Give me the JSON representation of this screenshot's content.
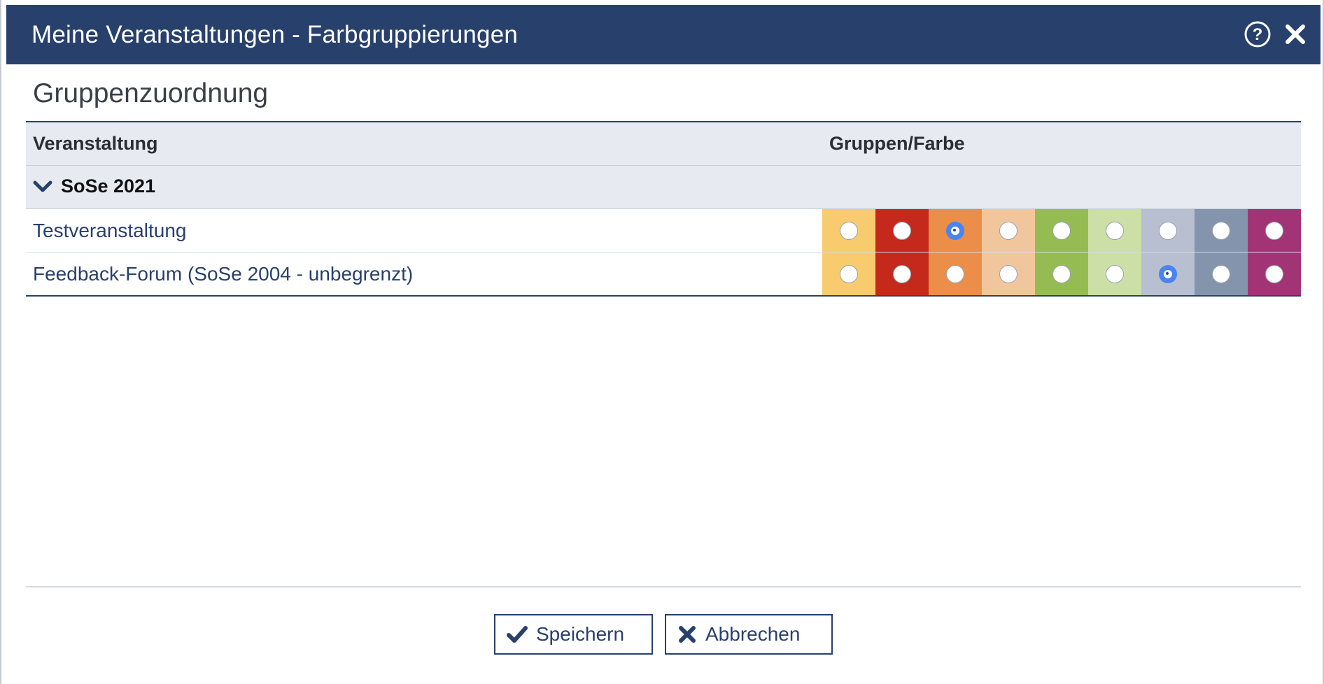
{
  "dialog": {
    "title": "Meine Veranstaltungen - Farbgruppierungen",
    "help_icon": "help-circle-icon",
    "close_icon": "close-icon"
  },
  "section_title": "Gruppenzuordnung",
  "table": {
    "col_course": "Veranstaltung",
    "col_group": "Gruppen/Farbe",
    "semester": "SoSe 2021",
    "colors": [
      "#f7cb6e",
      "#c4291c",
      "#ea8e4a",
      "#f2c69d",
      "#95bc52",
      "#cbdfa6",
      "#b7bfd0",
      "#8594ad",
      "#a23476"
    ],
    "rows": [
      {
        "name": "Testveranstaltung",
        "selected_group": 2
      },
      {
        "name": "Feedback-Forum (SoSe 2004 - unbegrenzt)",
        "selected_group": 6
      }
    ]
  },
  "buttons": {
    "save": "Speichern",
    "cancel": "Abbrechen"
  },
  "theme": {
    "primary": "#28406c",
    "radio_checked": "#4a84f0"
  }
}
